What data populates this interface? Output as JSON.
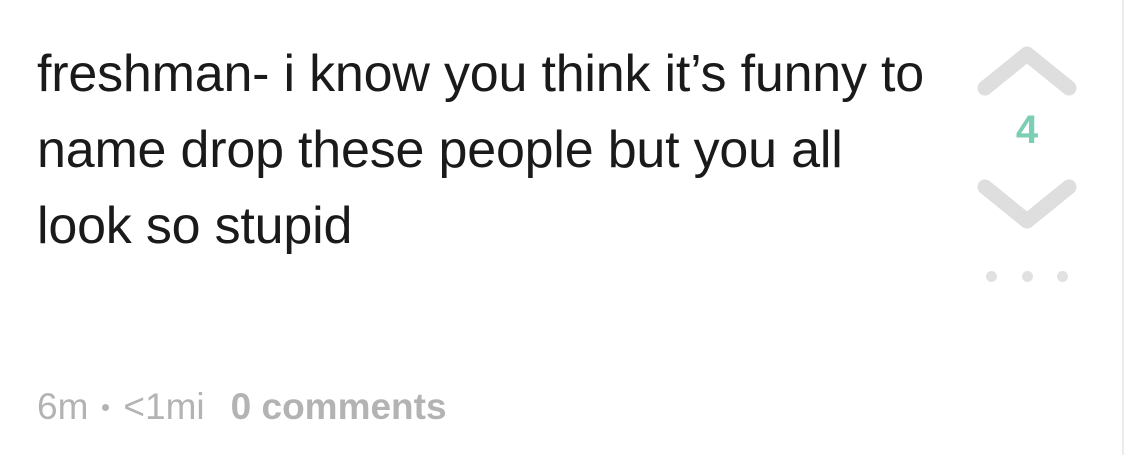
{
  "post": {
    "text": "freshman- i know you think it’s funny to name drop these people but you all look so stupid",
    "meta": {
      "age": "6m",
      "distance": "<1mi",
      "comments": "0 comments"
    }
  },
  "vote": {
    "score": "4",
    "up_icon": "chevron-up-icon",
    "down_icon": "chevron-down-icon"
  },
  "more_icon": "ellipsis-icon",
  "colors": {
    "score": "#7ccfb4",
    "chevron": "#dedede",
    "meta": "#b3b3b3",
    "text": "#1a1a1a"
  }
}
